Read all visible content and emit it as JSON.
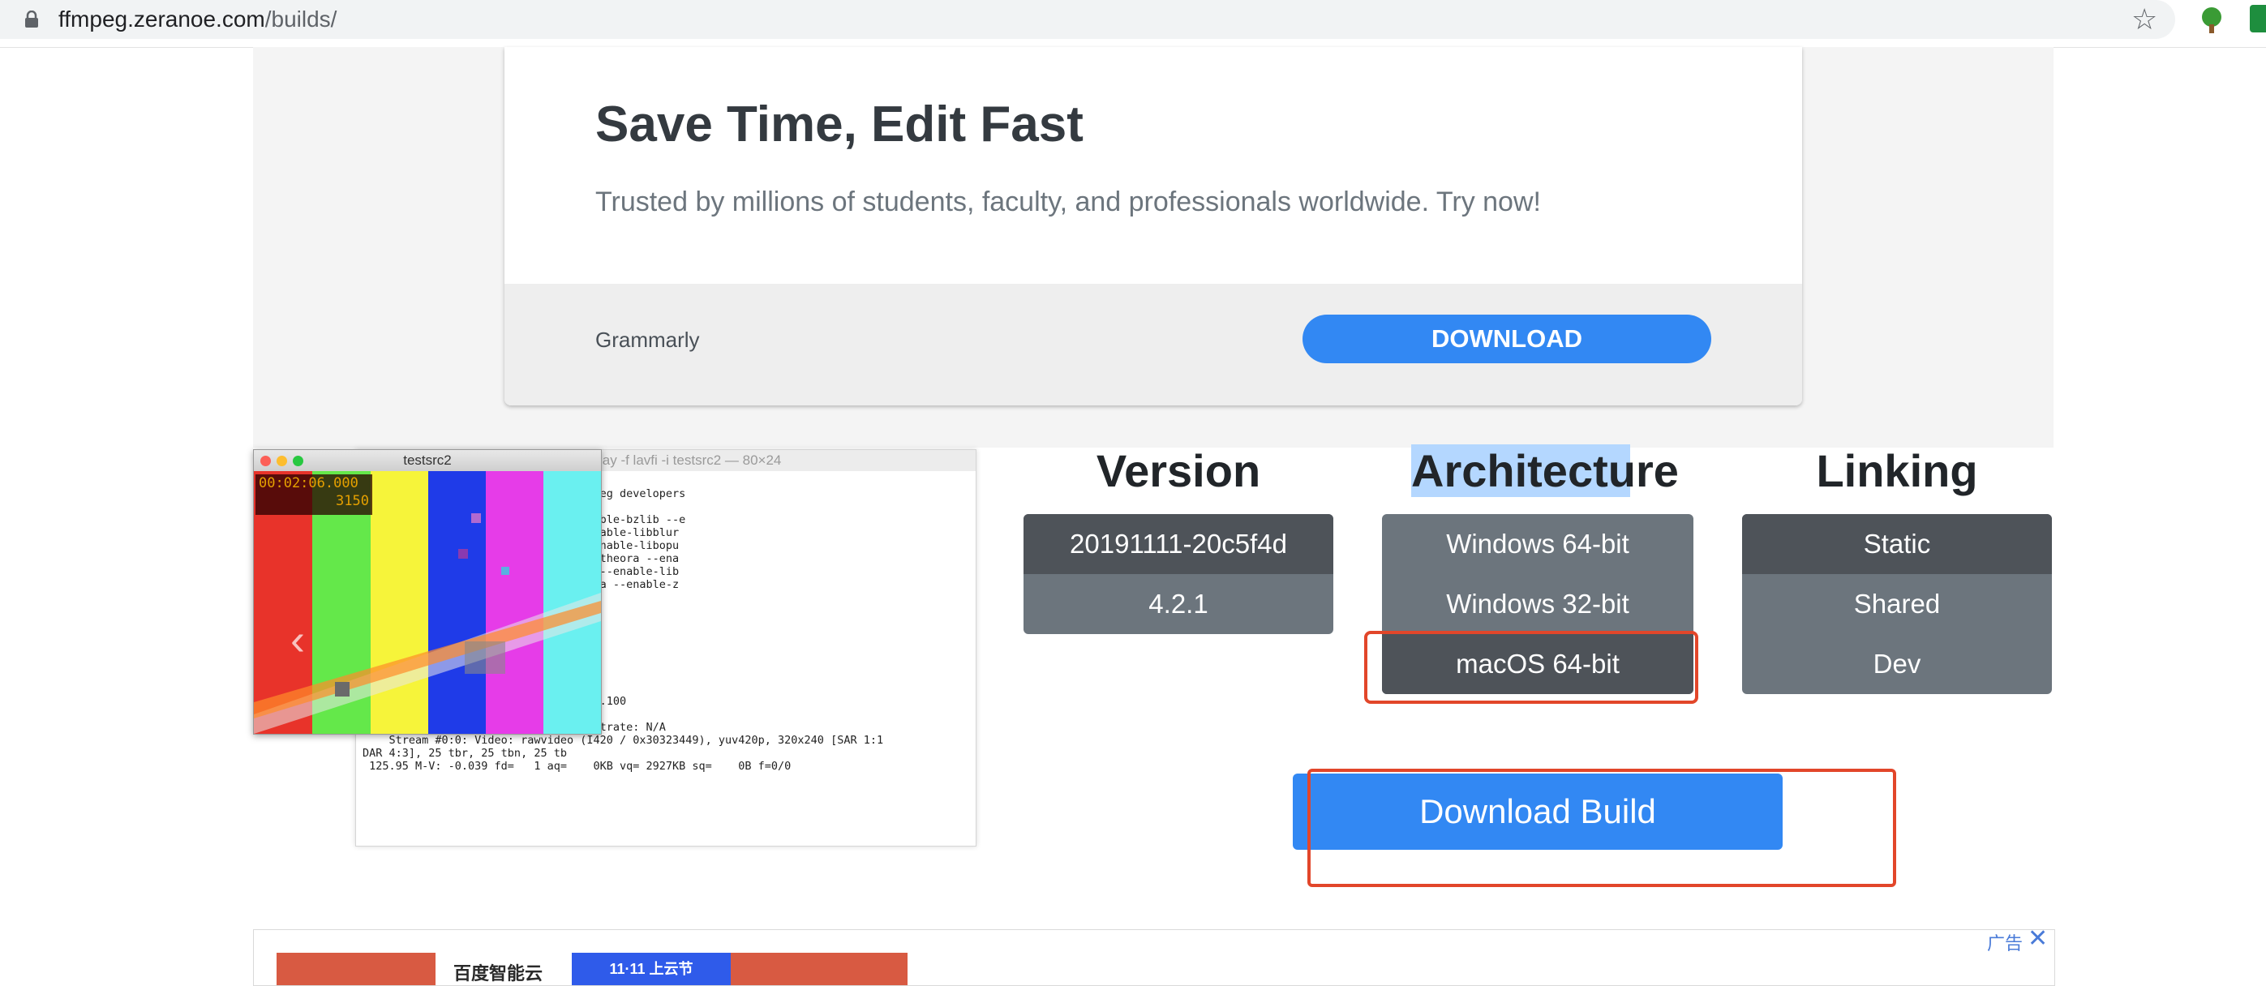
{
  "browser": {
    "url_host": "ffmpeg.zeranoe.com",
    "url_path": "/builds/"
  },
  "ad": {
    "title": "Save Time, Edit Fast",
    "subtitle": "Trusted by millions of students, faculty, and professionals worldwide. Try now!",
    "brand": "Grammarly",
    "button_label": "DOWNLOAD"
  },
  "preview": {
    "video_title": "testsrc2",
    "timecode": "00:02:06.000",
    "frame": "3150",
    "terminal_title": "lay -f lavfi -i testsrc2 — 80×24",
    "terminal_text": "ty -f lavfi -i testsrc2\n23f Copyright (c) 2003-2017 the FFmpeg developers\n9.0.0 (clang-900.0.37)\n-enable-version3 --enable-sdl2 --enable-bzlib --e\n --enable-iconv --enable-libass --enable-libblur\n-libmp3lame --enable-libopenjpeg --enable-libopu\nsnappy --enable-libsoxr --enable-libtheora --ena\n-enable-libwavpack --enable-libwebp --enable-lib\nibxml2 --enable-libzimg --enable-lzma --enable-z\nstab\n.  77.101\n7.106.104\n.  82.104\n7.   9.102\n.106.101\n.   7.103\n.   8.100\n  libpostproc    54.  6.100 / 54.  6.100\nInput #0, lavfi, from 'testsrc2':\n  Duration: N/A, start: 0.000000, bitrate: N/A\n    Stream #0:0: Video: rawvideo (I420 / 0x30323449), yuv420p, 320x240 [SAR 1:1\nDAR 4:3], 25 tbr, 25 tbn, 25 tb\n 125.95 M-V: -0.039 fd=   1 aq=    0KB vq= 2927KB sq=    0B f=0/0"
  },
  "builds": {
    "version_heading": "Version",
    "architecture_heading": "Architecture",
    "linking_heading": "Linking",
    "versions": [
      "20191111-20c5f4d",
      "4.2.1"
    ],
    "architectures": [
      "Windows 64-bit",
      "Windows 32-bit",
      "macOS 64-bit"
    ],
    "linking": [
      "Static",
      "Shared",
      "Dev"
    ],
    "selected_version": "20191111-20c5f4d",
    "selected_architecture": "macOS 64-bit",
    "selected_linking": "Static",
    "download_label": "Download Build"
  },
  "bottom_ad": {
    "logo_text": "百度智能云",
    "promo_text": "11·11 上云节",
    "ad_label": "广告"
  },
  "colors": {
    "primary": "#3288f3",
    "option_bg": "#6c757d",
    "option_active": "#4e5359",
    "highlight": "#e2462a"
  }
}
